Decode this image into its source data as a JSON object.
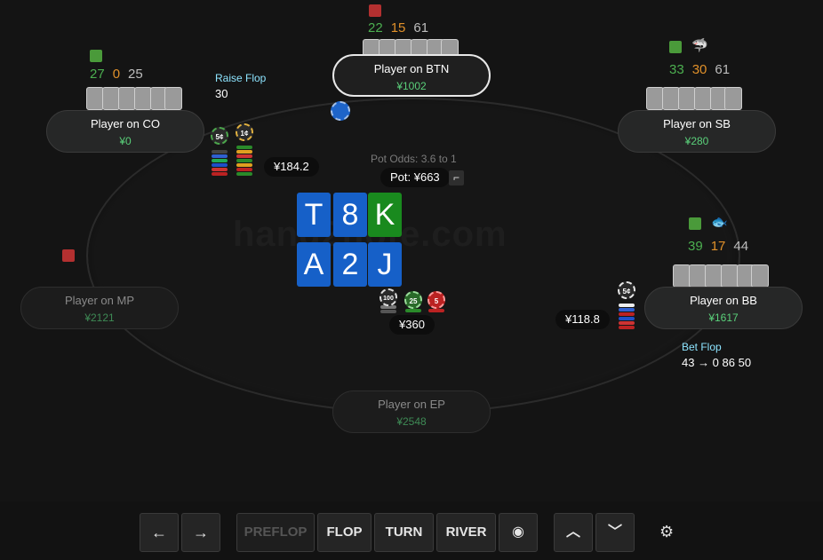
{
  "watermark": "hand2note.com",
  "pot_odds": "Pot Odds: 3.6 to 1",
  "pot": "Pot: ¥663",
  "board": {
    "flop": [
      "T",
      "8",
      "K"
    ],
    "turn_river": [
      "A",
      "2",
      "J"
    ]
  },
  "colors": {
    "card_blue": "#1660c8",
    "card_green": "#198a1e",
    "stack_green": "#5ad07a"
  },
  "seats": {
    "btn": {
      "name": "Player on BTN",
      "stack": "¥1002",
      "stats": [
        "22",
        "15",
        "61"
      ]
    },
    "co": {
      "name": "Player on CO",
      "stack": "¥0",
      "stats": [
        "27",
        "0",
        "25"
      ]
    },
    "sb": {
      "name": "Player on SB",
      "stack": "¥280",
      "stats": [
        "33",
        "30",
        "61"
      ]
    },
    "bb": {
      "name": "Player on BB",
      "stack": "¥1617",
      "stats": [
        "39",
        "17",
        "44"
      ]
    },
    "mp": {
      "name": "Player on MP",
      "stack": "¥2121"
    },
    "ep": {
      "name": "Player on EP",
      "stack": "¥2548"
    }
  },
  "bets": {
    "co": "¥184.2",
    "bb": "¥118.8",
    "pot_chips": "¥360"
  },
  "chip_labels": {
    "co": [
      "5¢",
      "1¢"
    ],
    "bb": "5¢",
    "pot": [
      "100",
      "25",
      "5"
    ]
  },
  "actions": {
    "co": {
      "label": "Raise Flop",
      "value": "30"
    },
    "bb": {
      "label": "Bet Flop",
      "value": "43  →  0   86   50"
    }
  },
  "controls": {
    "prev": "←",
    "next": "→",
    "preflop": "PREFLOP",
    "flop": "FLOP",
    "turn": "TURN",
    "river": "RIVER",
    "eye": "◉",
    "up": "︿",
    "down": "﹀",
    "settings": "⚙"
  }
}
